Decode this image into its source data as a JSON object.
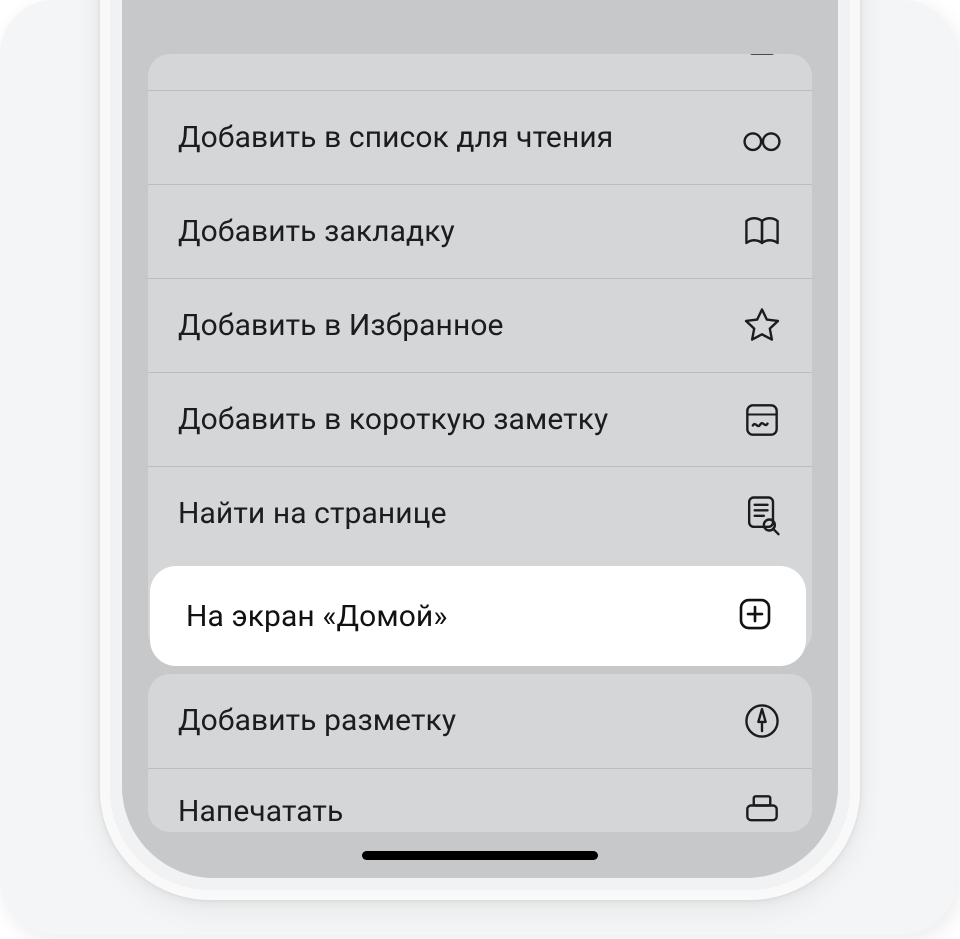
{
  "actions": {
    "partial_top_icon": "text-bookmark-icon",
    "reading_list": "Добавить в список для чтения",
    "bookmark": "Добавить закладку",
    "favorites": "Добавить в Избранное",
    "quick_note": "Добавить в короткую заметку",
    "find_on_page": "Найти на странице",
    "add_to_home": "На экран «Домой»",
    "markup": "Добавить разметку",
    "print": "Напечатать"
  }
}
